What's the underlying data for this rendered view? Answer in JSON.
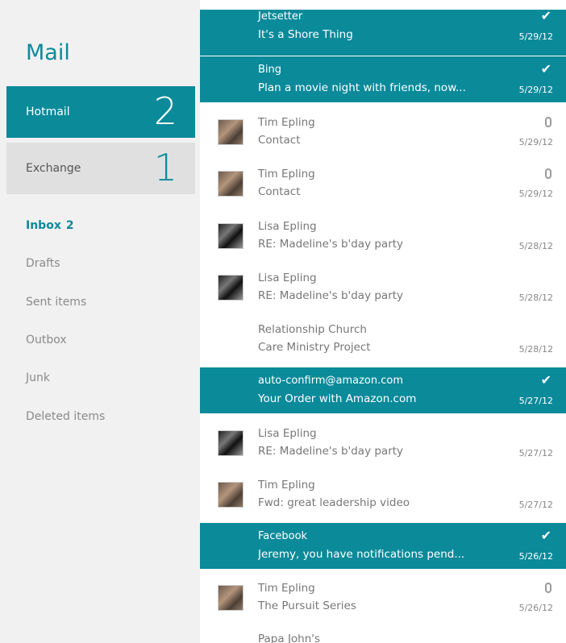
{
  "app": {
    "title": "Mail"
  },
  "accounts": [
    {
      "name": "Hotmail",
      "count": "2"
    },
    {
      "name": "Exchange",
      "count": "1"
    }
  ],
  "folders": [
    {
      "label": "Inbox",
      "count": "2"
    },
    {
      "label": "Drafts"
    },
    {
      "label": "Sent items"
    },
    {
      "label": "Outbox"
    },
    {
      "label": "Junk"
    },
    {
      "label": "Deleted items"
    }
  ],
  "messages": [
    {
      "sender": "Jetsetter",
      "subject": "It's a Shore Thing",
      "date": "5/29/12",
      "selected": true,
      "status": "✔"
    },
    {
      "sender": "Bing",
      "subject": "Plan a movie night with friends, now...",
      "date": "5/29/12",
      "selected": true,
      "status": "✔"
    },
    {
      "sender": "Tim Epling",
      "subject": "Contact",
      "date": "5/29/12",
      "attachment": true,
      "avatar": "tim-epling-photo"
    },
    {
      "sender": "Tim Epling",
      "subject": "Contact",
      "date": "5/29/12",
      "attachment": true,
      "avatar": "tim-epling-photo"
    },
    {
      "sender": "Lisa Epling",
      "subject": "RE: Madeline's b'day party",
      "date": "5/28/12",
      "avatar": "lisa-epling-photo"
    },
    {
      "sender": "Lisa Epling",
      "subject": "RE: Madeline's b'day party",
      "date": "5/28/12",
      "avatar": "lisa-epling-photo"
    },
    {
      "sender": "Relationship Church",
      "subject": "Care Ministry Project",
      "date": "5/28/12"
    },
    {
      "sender": "auto-confirm@amazon.com",
      "subject": "Your Order with Amazon.com",
      "date": "5/27/12",
      "selected": true,
      "status": "✔"
    },
    {
      "sender": "Lisa Epling",
      "subject": "RE: Madeline's b'day party",
      "date": "5/27/12",
      "avatar": "lisa-epling-photo"
    },
    {
      "sender": "Tim Epling",
      "subject": "Fwd: great leadership video",
      "date": "5/27/12",
      "avatar": "tim-epling-photo"
    },
    {
      "sender": "Facebook",
      "subject": "Jeremy, you have notifications pend...",
      "date": "5/26/12",
      "selected": true,
      "status": "✔"
    },
    {
      "sender": "Tim Epling",
      "subject": "The Pursuit Series",
      "date": "5/26/12",
      "attachment": true,
      "avatar": "tim-epling-photo"
    },
    {
      "sender": "Papa John's",
      "subject": "",
      "date": ""
    }
  ],
  "colors": {
    "accent": "#0b8a9a",
    "pane_bg": "#f1f1f1",
    "selected_account_bg": "#0b8a9a",
    "secondary_account_bg": "#e0e0e0"
  }
}
